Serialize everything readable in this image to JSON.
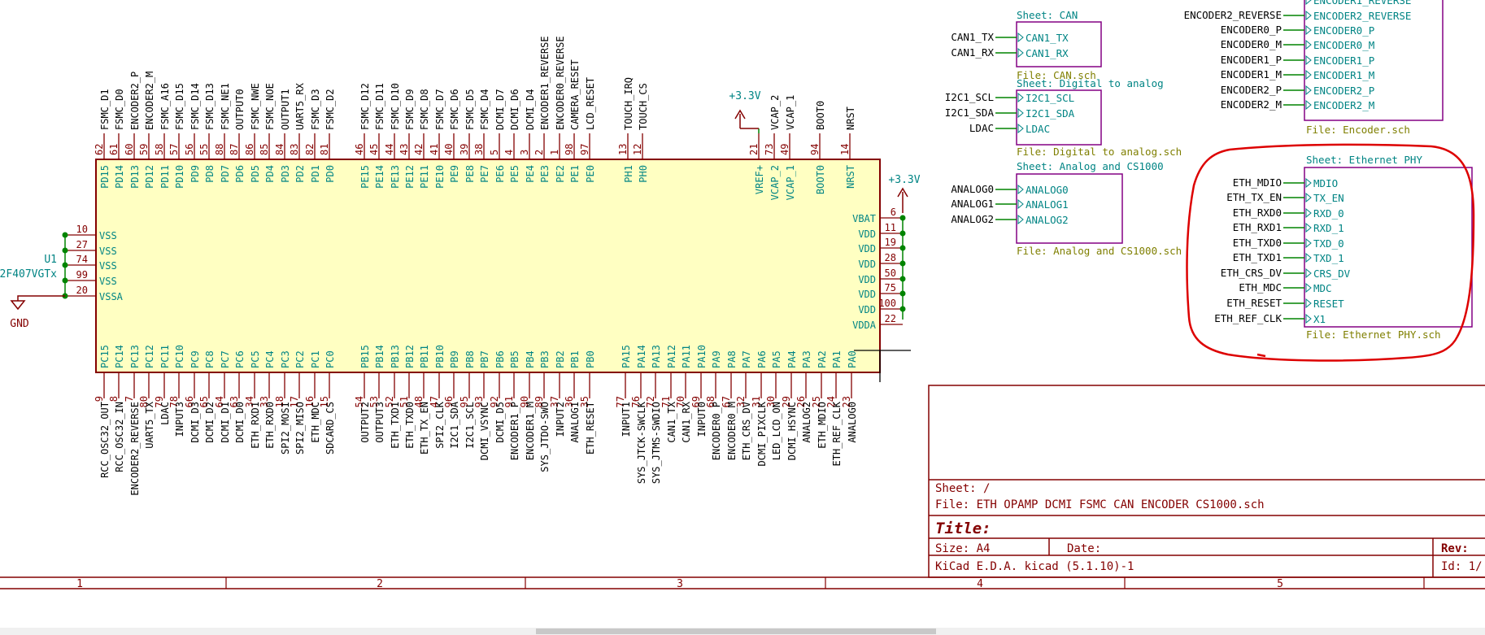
{
  "colors": {
    "body_fill": "#ffffc2",
    "body_border": "#840000",
    "pin": "#840000",
    "pin_name": "#008484",
    "net_label": "#000000",
    "sheet_border": "#840084",
    "sheet_name": "#008484",
    "sheet_file": "#7f7f00",
    "wire": "#008400",
    "power": "#840000",
    "annotation": "#dd0000",
    "frame": "#840000",
    "title_text": "#840000"
  },
  "mcu": {
    "reference": "U1",
    "value": "2F407VGTx",
    "top_pins": [
      {
        "num": "62",
        "name": "PD15",
        "net": "FSMC_D1"
      },
      {
        "num": "61",
        "name": "PD14",
        "net": "FSMC_D0"
      },
      {
        "num": "60",
        "name": "PD13",
        "net": "ENCODER2_P"
      },
      {
        "num": "59",
        "name": "PD12",
        "net": "ENCODER2_M"
      },
      {
        "num": "58",
        "name": "PD11",
        "net": "FSMC_A16"
      },
      {
        "num": "57",
        "name": "PD10",
        "net": "FSMC_D15"
      },
      {
        "num": "56",
        "name": "PD9",
        "net": "FSMC_D14"
      },
      {
        "num": "55",
        "name": "PD8",
        "net": "FSMC_D13"
      },
      {
        "num": "88",
        "name": "PD7",
        "net": "FSMC_NE1"
      },
      {
        "num": "87",
        "name": "PD6",
        "net": "OUTPUT0"
      },
      {
        "num": "86",
        "name": "PD5",
        "net": "FSMC_NWE"
      },
      {
        "num": "85",
        "name": "PD4",
        "net": "FSMC_NOE"
      },
      {
        "num": "84",
        "name": "PD3",
        "net": "OUTPUT1"
      },
      {
        "num": "83",
        "name": "PD2",
        "net": "UART5_RX"
      },
      {
        "num": "82",
        "name": "PD1",
        "net": "FSMC_D3"
      },
      {
        "num": "81",
        "name": "PD0",
        "net": "FSMC_D2"
      },
      {
        "num": "46",
        "name": "PE15",
        "net": "FSMC_D12"
      },
      {
        "num": "45",
        "name": "PE14",
        "net": "FSMC_D11"
      },
      {
        "num": "44",
        "name": "PE13",
        "net": "FSMC_D10"
      },
      {
        "num": "43",
        "name": "PE12",
        "net": "FSMC_D9"
      },
      {
        "num": "42",
        "name": "PE11",
        "net": "FSMC_D8"
      },
      {
        "num": "41",
        "name": "PE10",
        "net": "FSMC_D7"
      },
      {
        "num": "40",
        "name": "PE9",
        "net": "FSMC_D6"
      },
      {
        "num": "39",
        "name": "PE8",
        "net": "FSMC_D5"
      },
      {
        "num": "38",
        "name": "PE7",
        "net": "FSMC_D4"
      },
      {
        "num": "5",
        "name": "PE6",
        "net": "DCMI_D7"
      },
      {
        "num": "4",
        "name": "PE5",
        "net": "DCMI_D6"
      },
      {
        "num": "3",
        "name": "PE4",
        "net": "DCMI_D4"
      },
      {
        "num": "2",
        "name": "PE3",
        "net": "ENCODER1_REVERSE"
      },
      {
        "num": "1",
        "name": "PE2",
        "net": "ENCODER0_REVERSE"
      },
      {
        "num": "98",
        "name": "PE1",
        "net": "CAMERA_RESET"
      },
      {
        "num": "97",
        "name": "PE0",
        "net": "LCD_RESET"
      },
      {
        "num": "13",
        "name": "PH1",
        "net": "TOUCH_IRQ"
      },
      {
        "num": "12",
        "name": "PH0",
        "net": "TOUCH_CS"
      },
      {
        "num": "21",
        "name": "VREF+",
        "net": ""
      },
      {
        "num": "73",
        "name": "VCAP_2",
        "net": "VCAP_2"
      },
      {
        "num": "49",
        "name": "VCAP_1",
        "net": "VCAP_1"
      },
      {
        "num": "94",
        "name": "BOOT0",
        "net": "BOOT0"
      },
      {
        "num": "14",
        "name": "NRST",
        "net": "NRST"
      }
    ],
    "bottom_pins": [
      {
        "num": "9",
        "name": "PC15",
        "net": "RCC_OSC32_OUT"
      },
      {
        "num": "8",
        "name": "PC14",
        "net": "RCC_OSC32_IN"
      },
      {
        "num": "7",
        "name": "PC13",
        "net": "ENCODER2_REVERSE"
      },
      {
        "num": "80",
        "name": "PC12",
        "net": "UART5_TX"
      },
      {
        "num": "79",
        "name": "PC11",
        "net": "LDAC"
      },
      {
        "num": "78",
        "name": "PC10",
        "net": "INPUT3"
      },
      {
        "num": "66",
        "name": "PC9",
        "net": "DCMI_D3"
      },
      {
        "num": "65",
        "name": "PC8",
        "net": "DCMI_D2"
      },
      {
        "num": "64",
        "name": "PC7",
        "net": "DCMI_D1"
      },
      {
        "num": "63",
        "name": "PC6",
        "net": "DCMI_D0"
      },
      {
        "num": "34",
        "name": "PC5",
        "net": "ETH_RXD1"
      },
      {
        "num": "33",
        "name": "PC4",
        "net": "ETH_RXD0"
      },
      {
        "num": "18",
        "name": "PC3",
        "net": "SPI2_MOSI"
      },
      {
        "num": "17",
        "name": "PC2",
        "net": "SPI2_MISO"
      },
      {
        "num": "16",
        "name": "PC1",
        "net": "ETH_MDC"
      },
      {
        "num": "15",
        "name": "PC0",
        "net": "SDCARD_CS"
      },
      {
        "num": "54",
        "name": "PB15",
        "net": "OUTPUT2"
      },
      {
        "num": "53",
        "name": "PB14",
        "net": "OUTPUT3"
      },
      {
        "num": "52",
        "name": "PB13",
        "net": "ETH_TXD1"
      },
      {
        "num": "51",
        "name": "PB12",
        "net": "ETH_TXD0"
      },
      {
        "num": "48",
        "name": "PB11",
        "net": "ETH_TX_EN"
      },
      {
        "num": "47",
        "name": "PB10",
        "net": "SPI2_CLK"
      },
      {
        "num": "96",
        "name": "PB9",
        "net": "I2C1_SDA"
      },
      {
        "num": "95",
        "name": "PB8",
        "net": "I2C1_SCL"
      },
      {
        "num": "93",
        "name": "PB7",
        "net": "DCMI_VSYNC"
      },
      {
        "num": "92",
        "name": "PB6",
        "net": "DCMI_D5"
      },
      {
        "num": "91",
        "name": "PB5",
        "net": "ENCODER1_P"
      },
      {
        "num": "90",
        "name": "PB4",
        "net": "ENCODER1_M"
      },
      {
        "num": "89",
        "name": "PB3",
        "net": "SYS_JTDO-SWO"
      },
      {
        "num": "37",
        "name": "PB2",
        "net": "INPUT2"
      },
      {
        "num": "36",
        "name": "PB1",
        "net": "ANALOG1"
      },
      {
        "num": "35",
        "name": "PB0",
        "net": "ETH_RESET"
      },
      {
        "num": "77",
        "name": "PA15",
        "net": "INPUT1"
      },
      {
        "num": "76",
        "name": "PA14",
        "net": "SYS_JTCK-SWCLK"
      },
      {
        "num": "72",
        "name": "PA13",
        "net": "SYS_JTMS-SWDIO"
      },
      {
        "num": "71",
        "name": "PA12",
        "net": "CAN1_TX"
      },
      {
        "num": "70",
        "name": "PA11",
        "net": "CAN1_RX"
      },
      {
        "num": "69",
        "name": "PA10",
        "net": "INPUT0"
      },
      {
        "num": "68",
        "name": "PA9",
        "net": "ENCODER0_P"
      },
      {
        "num": "67",
        "name": "PA8",
        "net": "ENCODER0_M"
      },
      {
        "num": "32",
        "name": "PA7",
        "net": "ETH_CRS_DV"
      },
      {
        "num": "31",
        "name": "PA6",
        "net": "DCMI_PIXCLK"
      },
      {
        "num": "30",
        "name": "PA5",
        "net": "LED_LCD_ON"
      },
      {
        "num": "29",
        "name": "PA4",
        "net": "DCMI_HSYNC"
      },
      {
        "num": "26",
        "name": "PA3",
        "net": "ANALOG2"
      },
      {
        "num": "25",
        "name": "PA2",
        "net": "ETH_MDIO"
      },
      {
        "num": "24",
        "name": "PA1",
        "net": "ETH_REF_CLK"
      },
      {
        "num": "23",
        "name": "PA0",
        "net": "ANALOG0"
      }
    ],
    "left_pins": [
      {
        "num": "10",
        "name": "VSS"
      },
      {
        "num": "27",
        "name": "VSS"
      },
      {
        "num": "74",
        "name": "VSS"
      },
      {
        "num": "99",
        "name": "VSS"
      },
      {
        "num": "20",
        "name": "VSSA"
      }
    ],
    "right_pins": [
      {
        "num": "6",
        "name": "VBAT"
      },
      {
        "num": "11",
        "name": "VDD"
      },
      {
        "num": "19",
        "name": "VDD"
      },
      {
        "num": "28",
        "name": "VDD"
      },
      {
        "num": "50",
        "name": "VDD"
      },
      {
        "num": "75",
        "name": "VDD"
      },
      {
        "num": "100",
        "name": "VDD"
      },
      {
        "num": "22",
        "name": "VDDA"
      }
    ]
  },
  "power": {
    "gnd_label": "GND",
    "vref_label": "+3.3V",
    "vbat_label": "+3.3V"
  },
  "sheets": {
    "encoder": {
      "file": "File: Encoder.sch",
      "pins_partial": [
        "ENCODER1_REVERSE"
      ],
      "pins": [
        "ENCODER2_REVERSE",
        "ENCODER0_P",
        "ENCODER0_M",
        "ENCODER1_P",
        "ENCODER1_M",
        "ENCODER2_P",
        "ENCODER2_M"
      ],
      "left_nets": [
        "ENCODER2_REVERSE",
        "ENCODER0_P",
        "ENCODER0_M",
        "ENCODER1_P",
        "ENCODER1_M",
        "ENCODER2_P",
        "ENCODER2_M"
      ]
    },
    "can": {
      "name": "Sheet: CAN",
      "file": "File: CAN.sch",
      "pins": [
        "CAN1_TX",
        "CAN1_RX"
      ],
      "nets": [
        "CAN1_TX",
        "CAN1_RX"
      ]
    },
    "dac": {
      "name": "Sheet: Digital to analog",
      "file": "File: Digital to analog.sch",
      "pins": [
        "I2C1_SCL",
        "I2C1_SDA",
        "LDAC"
      ],
      "nets": [
        "I2C1_SCL",
        "I2C1_SDA",
        "LDAC"
      ]
    },
    "analog": {
      "name": "Sheet: Analog and CS1000",
      "file": "File: Analog and CS1000.sch",
      "pins": [
        "ANALOG0",
        "ANALOG1",
        "ANALOG2"
      ],
      "nets": [
        "ANALOG0",
        "ANALOG1",
        "ANALOG2"
      ]
    },
    "ethernet": {
      "name": "Sheet: Ethernet PHY",
      "file": "File: Ethernet PHY.sch",
      "pins": [
        "MDIO",
        "TX_EN",
        "RXD_0",
        "RXD_1",
        "TXD_0",
        "TXD_1",
        "CRS_DV",
        "MDC",
        "RESET",
        "X1"
      ],
      "nets": [
        "ETH_MDIO",
        "ETH_TX_EN",
        "ETH_RXD0",
        "ETH_RXD1",
        "ETH_TXD0",
        "ETH_TXD1",
        "ETH_CRS_DV",
        "ETH_MDC",
        "ETH_RESET",
        "ETH_REF_CLK"
      ]
    }
  },
  "title_block": {
    "sheet": "Sheet: /",
    "file": "File: ETH OPAMP DCMI FSMC CAN ENCODER CS1000.sch",
    "title": "Title:",
    "size": "Size: A4",
    "date": "Date:",
    "rev": "Rev:",
    "tool": "KiCad E.D.A.  kicad (5.1.10)-1",
    "id": "Id: 1/"
  },
  "frame_columns": [
    "1",
    "2",
    "3",
    "4",
    "5"
  ]
}
